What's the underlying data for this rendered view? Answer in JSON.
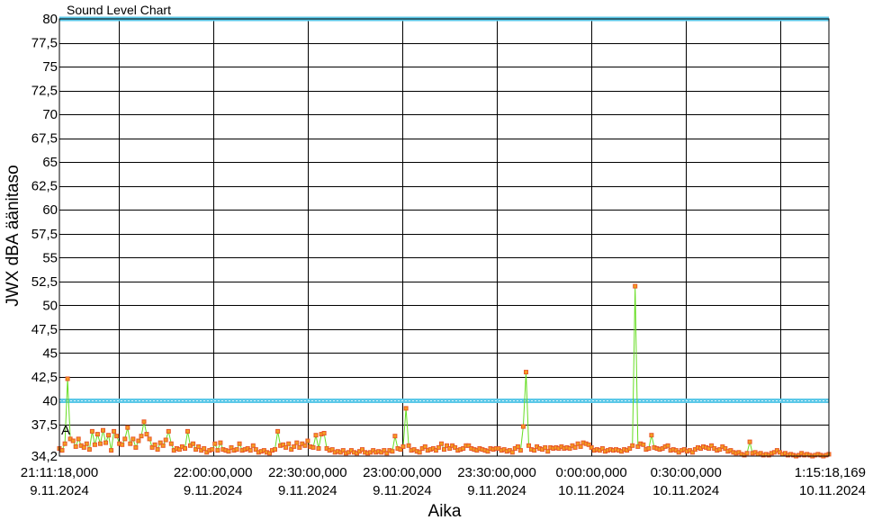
{
  "chart_data": {
    "type": "line",
    "title": "Sound Level Chart",
    "xlabel": "Aika",
    "ylabel": "JWX dBA äänitaso",
    "ylim": [
      34.2,
      80
    ],
    "xlim": [
      "2024-11-09 21:11:18",
      "2024-11-10 01:15:18"
    ],
    "grid": true,
    "y_ticks": [
      "34,2",
      "37,5",
      "40",
      "42,5",
      "45",
      "47,5",
      "50",
      "52,5",
      "55",
      "57,5",
      "60",
      "62,5",
      "65",
      "67,5",
      "70",
      "72,5",
      "75",
      "77,5",
      "80"
    ],
    "x_ticks": [
      {
        "time": "2024-11-09 21:11:18",
        "line1": "21:11:18,000",
        "line2": "9.11.2024"
      },
      {
        "time": "2024-11-09 22:00:00",
        "line1": "22:00:00,000",
        "line2": "9.11.2024"
      },
      {
        "time": "2024-11-09 22:30:00",
        "line1": "22:30:00,000",
        "line2": "9.11.2024"
      },
      {
        "time": "2024-11-09 23:00:00",
        "line1": "23:00:00,000",
        "line2": "9.11.2024"
      },
      {
        "time": "2024-11-09 23:30:00",
        "line1": "23:30:00,000",
        "line2": "9.11.2024"
      },
      {
        "time": "2024-11-10 00:00:00",
        "line1": "0:00:00,000",
        "line2": "10.11.2024"
      },
      {
        "time": "2024-11-10 00:30:00",
        "line1": "0:30:00,000",
        "line2": "10.11.2024"
      },
      {
        "time": "2024-11-10 01:15:18",
        "line1": "1:15:18,169",
        "line2": "10.11.2024"
      }
    ],
    "grid_x_times": [
      "2024-11-09 21:30:00",
      "2024-11-09 22:00:00",
      "2024-11-09 22:30:00",
      "2024-11-09 23:00:00",
      "2024-11-09 23:30:00",
      "2024-11-10 00:00:00",
      "2024-11-10 00:30:00",
      "2024-11-10 01:00:00"
    ],
    "reference_lines": [
      {
        "value": 40,
        "color": "#5bc8e8"
      },
      {
        "value": 80,
        "color": "#5bc8e8"
      }
    ],
    "annotations": [
      {
        "text": "A",
        "time": "2024-11-09 21:11:18",
        "value": 35.9
      }
    ],
    "series": [
      {
        "line_color": "#66dd22",
        "marker_color": "#e8582a",
        "marker_fill": "#f4a020",
        "start": "2024-11-09 21:11:18",
        "end": "2024-11-10 01:15:18",
        "values": [
          35.0,
          34.8,
          35.5,
          42.3,
          36.0,
          35.8,
          35.2,
          36.0,
          35.3,
          35.1,
          35.5,
          34.9,
          36.8,
          35.4,
          36.5,
          35.5,
          36.9,
          35.6,
          36.4,
          34.8,
          36.8,
          36.3,
          35.5,
          35.4,
          36.0,
          37.2,
          35.5,
          36.0,
          35.1,
          35.8,
          36.3,
          37.8,
          36.5,
          36.0,
          35.1,
          35.4,
          34.9,
          35.6,
          35.3,
          35.9,
          36.8,
          35.5,
          34.8,
          35.0,
          34.9,
          35.2,
          35.0,
          36.8,
          35.3,
          35.5,
          34.9,
          35.2,
          34.8,
          35.0,
          34.6,
          34.8,
          34.9,
          35.5,
          34.8,
          35.6,
          34.9,
          34.8,
          34.7,
          35.1,
          34.8,
          34.9,
          35.5,
          34.8,
          34.9,
          35.0,
          34.8,
          35.3,
          34.9,
          34.6,
          34.7,
          34.8,
          34.6,
          34.5,
          34.8,
          34.9,
          36.8,
          35.3,
          35.4,
          35.1,
          35.5,
          34.9,
          35.2,
          35.6,
          35.1,
          35.5,
          35.3,
          35.8,
          35.2,
          35.1,
          36.4,
          35.0,
          36.5,
          36.6,
          35.0,
          34.8,
          34.9,
          34.6,
          34.7,
          34.6,
          34.8,
          34.5,
          34.6,
          34.8,
          34.6,
          34.5,
          34.7,
          34.9,
          34.6,
          34.5,
          34.6,
          34.8,
          34.6,
          34.7,
          34.6,
          34.8,
          34.5,
          34.8,
          34.7,
          36.3,
          35.0,
          34.9,
          35.2,
          39.2,
          35.3,
          34.8,
          34.9,
          34.7,
          34.6,
          35.0,
          35.2,
          34.8,
          34.9,
          35.0,
          34.8,
          35.1,
          35.5,
          34.9,
          35.3,
          35.0,
          35.3,
          35.1,
          34.8,
          34.9,
          35.0,
          35.3,
          35.3,
          35.0,
          34.9,
          34.8,
          35.0,
          34.9,
          34.8,
          34.7,
          35.0,
          34.9,
          35.0,
          35.0,
          34.8,
          34.9,
          34.7,
          34.8,
          34.6,
          35.0,
          35.2,
          34.8,
          37.3,
          43.0,
          35.3,
          34.9,
          34.8,
          35.2,
          35.0,
          34.9,
          35.1,
          34.7,
          35.1,
          35.0,
          35.1,
          35.0,
          35.2,
          35.0,
          35.1,
          35.0,
          35.3,
          35.1,
          35.5,
          35.2,
          35.6,
          35.5,
          35.4,
          35.1,
          34.8,
          34.9,
          34.8,
          35.0,
          34.7,
          34.8,
          34.9,
          34.8,
          34.9,
          34.8,
          34.7,
          34.9,
          34.8,
          35.0,
          35.3,
          52.0,
          35.2,
          35.5,
          35.4,
          34.9,
          35.0,
          36.4,
          35.1,
          35.0,
          34.9,
          35.0,
          35.2,
          35.3,
          34.8,
          34.9,
          34.8,
          34.6,
          34.8,
          34.9,
          34.7,
          34.8,
          34.6,
          34.9,
          35.1,
          35.0,
          35.2,
          35.1,
          35.0,
          35.3,
          35.0,
          34.8,
          34.9,
          35.2,
          35.0,
          34.7,
          34.8,
          34.6,
          34.5,
          34.6,
          34.4,
          34.3,
          34.5,
          35.7,
          34.5,
          34.6,
          34.4,
          34.5,
          34.3,
          34.4,
          34.3,
          34.5,
          34.6,
          34.8,
          34.6,
          34.4,
          34.5,
          34.3,
          34.4,
          34.3,
          34.2,
          34.3,
          34.5,
          34.3,
          34.4,
          34.3,
          34.2,
          34.3,
          34.4,
          34.3,
          34.2,
          34.3,
          34.4
        ]
      }
    ]
  }
}
